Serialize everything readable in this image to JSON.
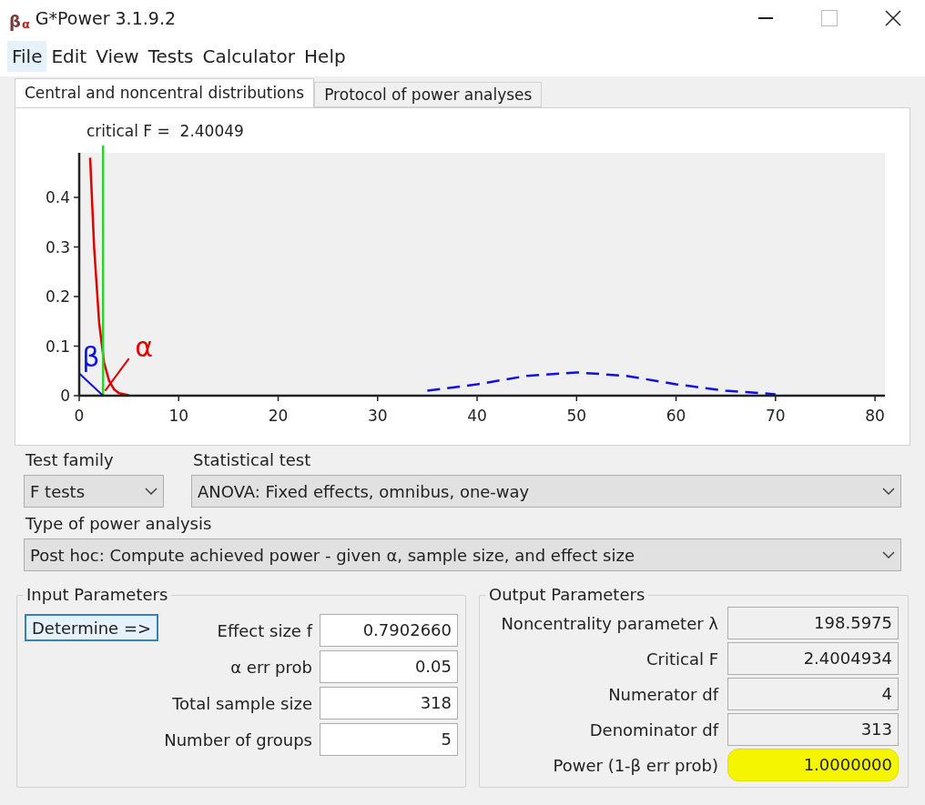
{
  "window": {
    "title": "G*Power 3.1.9.2",
    "icon_glyphs": [
      "β",
      "α"
    ]
  },
  "menu": [
    {
      "label": "File",
      "selected": true
    },
    {
      "label": "Edit",
      "selected": false
    },
    {
      "label": "View",
      "selected": false
    },
    {
      "label": "Tests",
      "selected": false
    },
    {
      "label": "Calculator",
      "selected": false
    },
    {
      "label": "Help",
      "selected": false
    }
  ],
  "tabs": [
    {
      "label": "Central and noncentral distributions",
      "selected": true
    },
    {
      "label": "Protocol of power analyses",
      "selected": false
    }
  ],
  "plot": {
    "chart_data": {
      "type": "line",
      "x": [
        1.1,
        1.5,
        2,
        2.5,
        3,
        3.5,
        4,
        5,
        35,
        40,
        45,
        50,
        55,
        60,
        65,
        70
      ],
      "series": [
        {
          "color": "#e00000",
          "values": [
            0.48,
            0.299,
            0.147,
            0.067,
            0.03,
            0.013,
            0.005,
            0.001,
            null,
            null,
            null,
            null,
            null,
            null,
            null,
            null
          ]
        },
        {
          "color": "#1010e0",
          "line_style": "dashed",
          "values": [
            null,
            null,
            null,
            null,
            null,
            null,
            null,
            null,
            0.01,
            0.023,
            0.04,
            0.047,
            0.04,
            0.023,
            0.01,
            0.003
          ]
        }
      ],
      "xlim": [
        0,
        81
      ],
      "ylim": [
        0,
        0.49
      ],
      "xticks": [
        0,
        10,
        20,
        30,
        40,
        50,
        60,
        70,
        80
      ],
      "yticks": [
        0,
        0.1,
        0.2,
        0.3,
        0.4
      ],
      "ref_lines": [
        {
          "axis": "x",
          "value": 2.40049,
          "label": "critical F =  2.40049"
        }
      ],
      "annotations": [
        "β",
        "α"
      ]
    }
  },
  "test_family": {
    "label": "Test family",
    "value": "F tests"
  },
  "statistical_test": {
    "label": "Statistical test",
    "value": "ANOVA: Fixed effects, omnibus, one-way"
  },
  "type_of_power_analysis": {
    "label": "Type of power analysis",
    "value": "Post hoc: Compute achieved power - given α, sample size, and effect size"
  },
  "input_parameters": {
    "title": "Input Parameters",
    "determine_button": "Determine =>",
    "fields": [
      {
        "label": "Effect size f",
        "value": "0.7902660"
      },
      {
        "label": "α err prob",
        "value": "0.05"
      },
      {
        "label": "Total sample size",
        "value": "318"
      },
      {
        "label": "Number of groups",
        "value": "5"
      }
    ]
  },
  "output_parameters": {
    "title": "Output Parameters",
    "fields": [
      {
        "label": "Noncentrality parameter λ",
        "value": "198.5975",
        "highlighted": false
      },
      {
        "label": "Critical F",
        "value": "2.4004934",
        "highlighted": false
      },
      {
        "label": "Numerator df",
        "value": "4",
        "highlighted": false
      },
      {
        "label": "Denominator df",
        "value": "313",
        "highlighted": false
      },
      {
        "label": "Power (1-β err prob)",
        "value": "1.0000000",
        "highlighted": true
      }
    ]
  }
}
